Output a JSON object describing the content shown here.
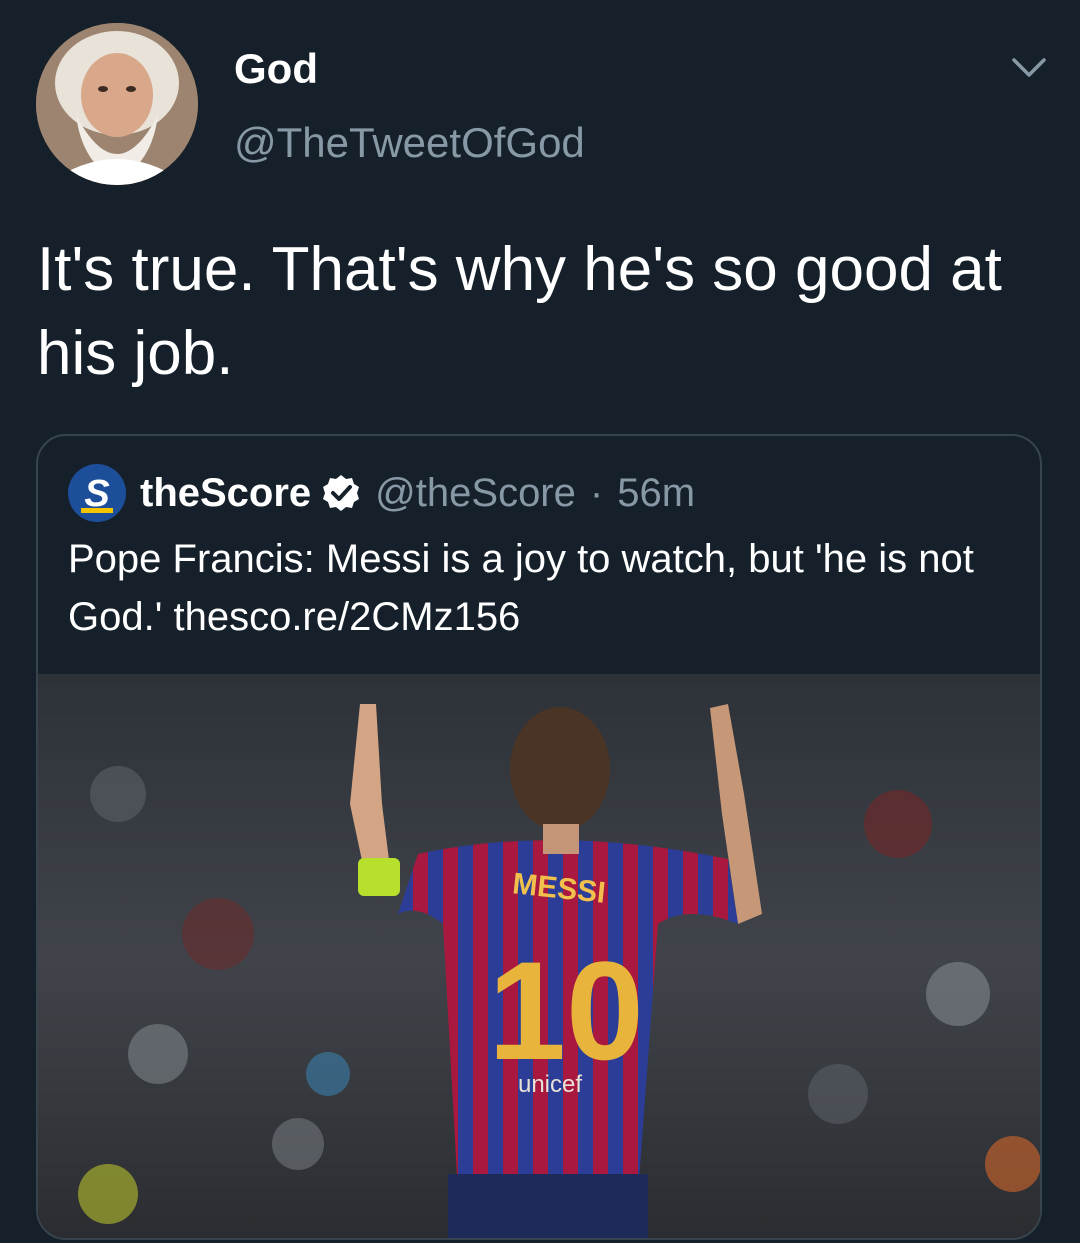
{
  "tweet": {
    "display_name": "God",
    "handle": "@TheTweetOfGod",
    "text": "It's true. That's why he's so good at his job."
  },
  "quoted": {
    "display_name": "theScore",
    "handle": "@theScore",
    "separator": "·",
    "time": "56m",
    "text": "Pope Francis: Messi is a joy to watch, but 'he is not God.' thesco.re/2CMz156",
    "media": {
      "jersey_name": "MESSI",
      "jersey_number": "10",
      "sponsor": "unicef"
    }
  },
  "icons": {
    "menu": "chevron-down-icon",
    "verified": "verified-badge-icon",
    "logo": "thescore-logo"
  },
  "colors": {
    "background": "#15202b",
    "border": "#38444d",
    "secondary_text": "#8899a6",
    "verified_badge": "#ffffff"
  }
}
